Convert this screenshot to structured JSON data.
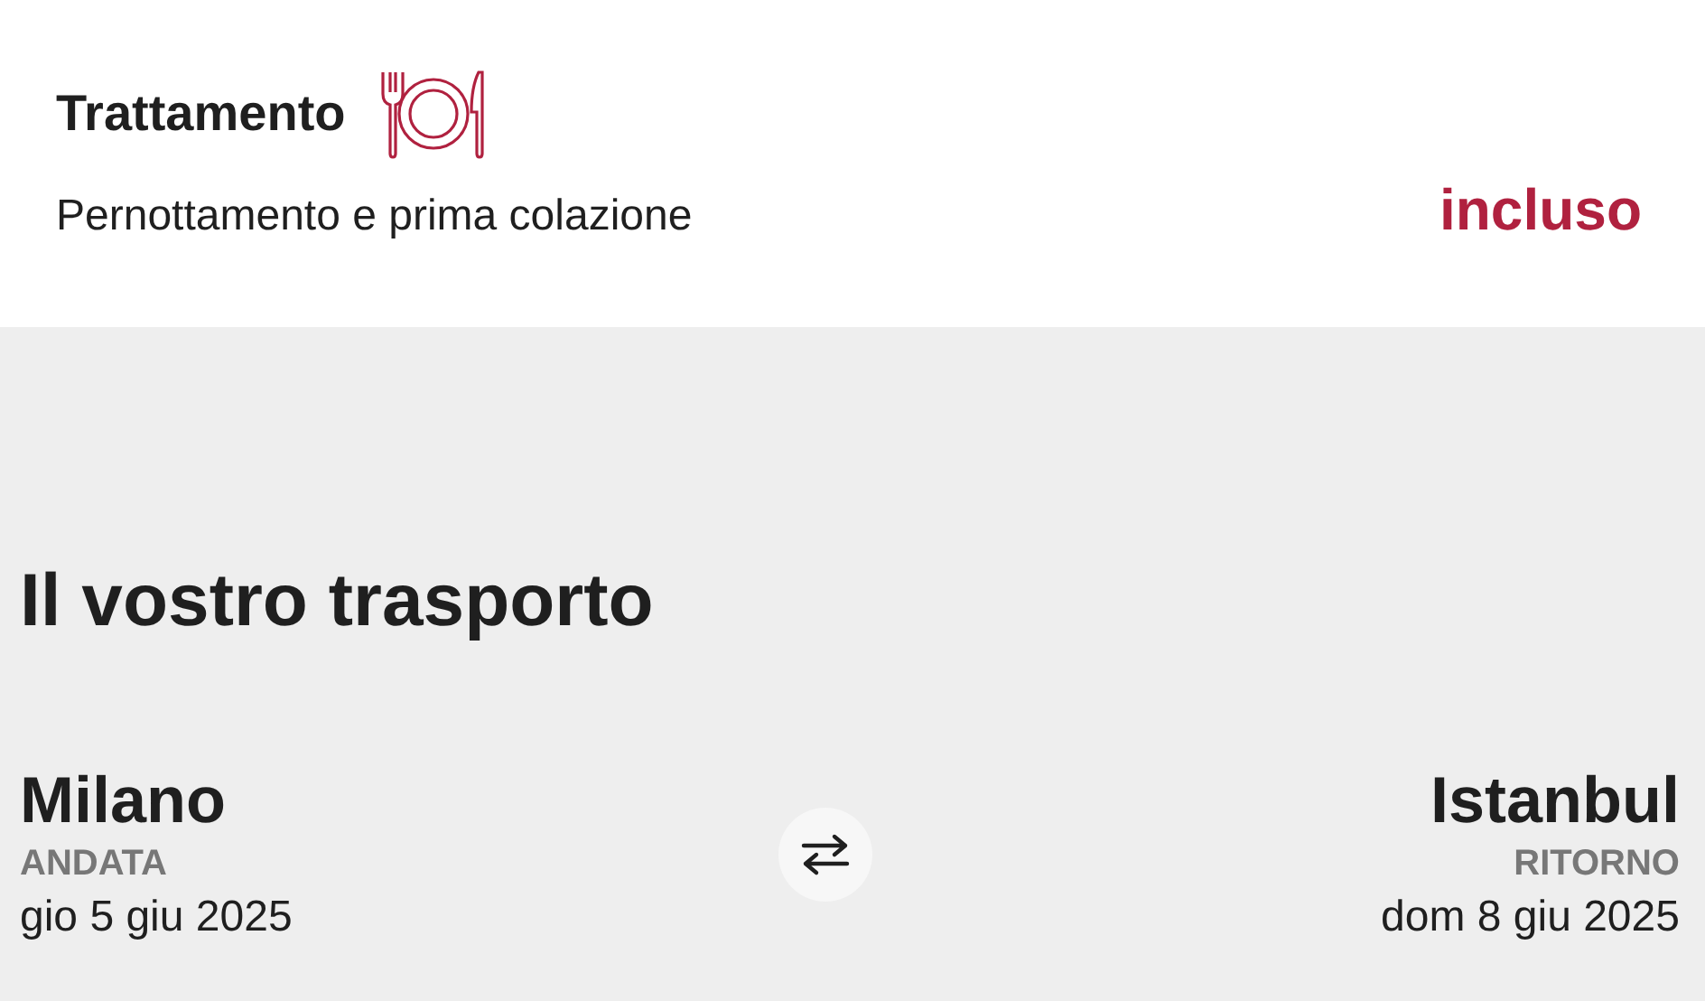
{
  "board": {
    "title": "Trattamento",
    "description": "Pernottamento e prima colazione",
    "status": "incluso"
  },
  "transport": {
    "title": "Il vostro trasporto",
    "legs": [
      {
        "city": "Milano",
        "label": "ANDATA",
        "date": "gio 5 giu 2025"
      },
      {
        "city": "Istanbul",
        "label": "RITORNO",
        "date": "dom 8 giu 2025"
      }
    ]
  }
}
